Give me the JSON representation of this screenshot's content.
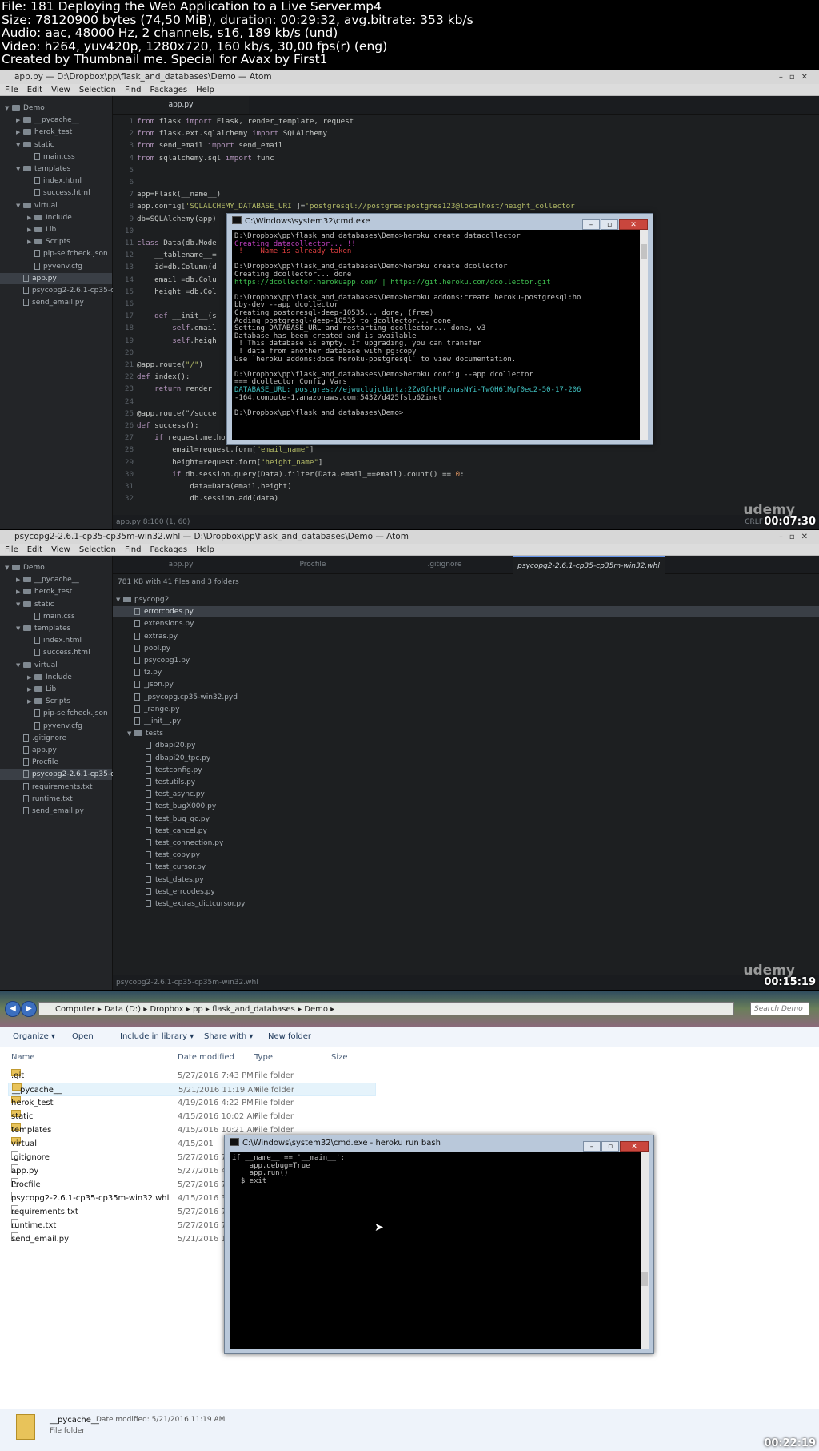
{
  "header": {
    "line1": "File: 181 Deploying the Web Application to a Live Server.mp4",
    "line2": "Size: 78120900 bytes (74,50 MiB), duration: 00:29:32, avg.bitrate: 353 kb/s",
    "line3": "Audio: aac, 48000 Hz, 2 channels, s16, 189 kb/s (und)",
    "line4": "Video: h264, yuv420p, 1280x720, 160 kb/s, 30,00 fps(r) (eng)",
    "line5": "Created by Thumbnail me. Special for Avax by First1"
  },
  "frame1": {
    "title": "app.py — D:\\Dropbox\\pp\\flask_and_databases\\Demo — Atom",
    "menu": [
      "File",
      "Edit",
      "View",
      "Selection",
      "Find",
      "Packages",
      "Help"
    ],
    "tab": "app.py",
    "tree": [
      {
        "label": "Demo",
        "kind": "root"
      },
      {
        "label": "__pycache__",
        "kind": "folder",
        "indent": 1
      },
      {
        "label": "herok_test",
        "kind": "folder",
        "indent": 1
      },
      {
        "label": "static",
        "kind": "folder-open",
        "indent": 1
      },
      {
        "label": "main.css",
        "kind": "file",
        "indent": 2
      },
      {
        "label": "templates",
        "kind": "folder-open",
        "indent": 1
      },
      {
        "label": "index.html",
        "kind": "file",
        "indent": 2
      },
      {
        "label": "success.html",
        "kind": "file",
        "indent": 2
      },
      {
        "label": "virtual",
        "kind": "folder-open",
        "indent": 1
      },
      {
        "label": "Include",
        "kind": "folder",
        "indent": 2
      },
      {
        "label": "Lib",
        "kind": "folder",
        "indent": 2
      },
      {
        "label": "Scripts",
        "kind": "folder",
        "indent": 2
      },
      {
        "label": "pip-selfcheck.json",
        "kind": "file",
        "indent": 2
      },
      {
        "label": "pyvenv.cfg",
        "kind": "file",
        "indent": 2
      },
      {
        "label": "app.py",
        "kind": "file",
        "indent": 1,
        "selected": true
      },
      {
        "label": "psycopg2-2.6.1-cp35-cp",
        "kind": "file",
        "indent": 1
      },
      {
        "label": "send_email.py",
        "kind": "file",
        "indent": 1
      }
    ],
    "lines": [
      {
        "n": "1",
        "t": "from flask import Flask, render_template, request"
      },
      {
        "n": "2",
        "t": "from flask.ext.sqlalchemy import SQLAlchemy"
      },
      {
        "n": "3",
        "t": "from send_email import send_email"
      },
      {
        "n": "4",
        "t": "from sqlalchemy.sql import func"
      },
      {
        "n": "5",
        "t": ""
      },
      {
        "n": "6",
        "t": ""
      },
      {
        "n": "7",
        "t": "app=Flask(__name__)"
      },
      {
        "n": "8",
        "t": "app.config['SQLALCHEMY_DATABASE_URI']='postgresql://postgres:postgres123@localhost/height_collector'"
      },
      {
        "n": "9",
        "t": "db=SQLAlchemy(app)"
      },
      {
        "n": "10",
        "t": ""
      },
      {
        "n": "11",
        "t": "class Data(db.Mode"
      },
      {
        "n": "12",
        "t": "    __tablename__="
      },
      {
        "n": "13",
        "t": "    id=db.Column(d"
      },
      {
        "n": "14",
        "t": "    email_=db.Colu"
      },
      {
        "n": "15",
        "t": "    height_=db.Col"
      },
      {
        "n": "16",
        "t": ""
      },
      {
        "n": "17",
        "t": "    def __init__(s"
      },
      {
        "n": "18",
        "t": "        self.email"
      },
      {
        "n": "19",
        "t": "        self.heigh"
      },
      {
        "n": "20",
        "t": ""
      },
      {
        "n": "21",
        "t": "@app.route(\"/\")"
      },
      {
        "n": "22",
        "t": "def index():"
      },
      {
        "n": "23",
        "t": "    return render_"
      },
      {
        "n": "24",
        "t": ""
      },
      {
        "n": "25",
        "t": "@app.route(\"/succe"
      },
      {
        "n": "26",
        "t": "def success():"
      },
      {
        "n": "27",
        "t": "    if request.method=='POST':"
      },
      {
        "n": "28",
        "t": "        email=request.form[\"email_name\"]"
      },
      {
        "n": "29",
        "t": "        height=request.form[\"height_name\"]"
      },
      {
        "n": "30",
        "t": "        if db.session.query(Data).filter(Data.email_==email).count() == 0:"
      },
      {
        "n": "31",
        "t": "            data=Data(email,height)"
      },
      {
        "n": "32",
        "t": "            db.session.add(data)"
      }
    ],
    "status_left": "app.py   8:100   (1, 60)",
    "status_right": "CRLF",
    "watermark": "udemy",
    "timestamp": "00:07:30",
    "cmd": {
      "title": "C:\\Windows\\system32\\cmd.exe",
      "lines": [
        {
          "t": "D:\\Dropbox\\pp\\flask_and_databases\\Demo>heroku create datacollector",
          "c": ""
        },
        {
          "t": "Creating datacollector... !!!",
          "c": "mg"
        },
        {
          "t": " !    Name is already taken",
          "c": "rd"
        },
        {
          "t": "",
          "c": ""
        },
        {
          "t": "D:\\Dropbox\\pp\\flask_and_databases\\Demo>heroku create dcollector",
          "c": ""
        },
        {
          "t": "Creating dcollector... done",
          "c": ""
        },
        {
          "t": "https://dcollector.herokuapp.com/ | https://git.heroku.com/dcollector.git",
          "c": "gr"
        },
        {
          "t": "",
          "c": ""
        },
        {
          "t": "D:\\Dropbox\\pp\\flask_and_databases\\Demo>heroku addons:create heroku-postgresql:ho",
          "c": ""
        },
        {
          "t": "bby-dev --app dcollector",
          "c": ""
        },
        {
          "t": "Creating postgresql-deep-10535... done, (free)",
          "c": ""
        },
        {
          "t": "Adding postgresql-deep-10535 to dcollector... done",
          "c": ""
        },
        {
          "t": "Setting DATABASE_URL and restarting dcollector... done, v3",
          "c": ""
        },
        {
          "t": "Database has been created and is available",
          "c": ""
        },
        {
          "t": " ! This database is empty. If upgrading, you can transfer",
          "c": ""
        },
        {
          "t": " ! data from another database with pg:copy",
          "c": ""
        },
        {
          "t": "Use `heroku addons:docs heroku-postgresql` to view documentation.",
          "c": ""
        },
        {
          "t": "",
          "c": ""
        },
        {
          "t": "D:\\Dropbox\\pp\\flask_and_databases\\Demo>heroku config --app dcollector",
          "c": ""
        },
        {
          "t": "=== dcollector Config Vars",
          "c": ""
        },
        {
          "t": "DATABASE_URL: postgres://ejwuclujctbntz:2ZvGfcHUFzmasNYi-TwQH6lMgf0ec2-50-17-206",
          "c": "cy"
        },
        {
          "t": "-164.compute-1.amazonaws.com:5432/d425fslp62inet",
          "c": ""
        },
        {
          "t": "",
          "c": ""
        },
        {
          "t": "D:\\Dropbox\\pp\\flask_and_databases\\Demo>",
          "c": ""
        }
      ]
    }
  },
  "frame2": {
    "title": "psycopg2-2.6.1-cp35-cp35m-win32.whl — D:\\Dropbox\\pp\\flask_and_databases\\Demo — Atom",
    "menu": [
      "File",
      "Edit",
      "View",
      "Selection",
      "Find",
      "Packages",
      "Help"
    ],
    "tabs": [
      "app.py",
      "Procfile",
      ".gitignore",
      "psycopg2-2.6.1-cp35-cp35m-win32.whl"
    ],
    "tree": [
      {
        "label": "Demo",
        "kind": "root"
      },
      {
        "label": "__pycache__",
        "kind": "folder",
        "indent": 1
      },
      {
        "label": "herok_test",
        "kind": "folder",
        "indent": 1
      },
      {
        "label": "static",
        "kind": "folder-open",
        "indent": 1
      },
      {
        "label": "main.css",
        "kind": "file",
        "indent": 2
      },
      {
        "label": "templates",
        "kind": "folder-open",
        "indent": 1
      },
      {
        "label": "index.html",
        "kind": "file",
        "indent": 2
      },
      {
        "label": "success.html",
        "kind": "file",
        "indent": 2
      },
      {
        "label": "virtual",
        "kind": "folder-open",
        "indent": 1
      },
      {
        "label": "Include",
        "kind": "folder",
        "indent": 2
      },
      {
        "label": "Lib",
        "kind": "folder",
        "indent": 2
      },
      {
        "label": "Scripts",
        "kind": "folder",
        "indent": 2
      },
      {
        "label": "pip-selfcheck.json",
        "kind": "file",
        "indent": 2
      },
      {
        "label": "pyvenv.cfg",
        "kind": "file",
        "indent": 2
      },
      {
        "label": ".gitignore",
        "kind": "file",
        "indent": 1
      },
      {
        "label": "app.py",
        "kind": "file",
        "indent": 1
      },
      {
        "label": "Procfile",
        "kind": "file",
        "indent": 1
      },
      {
        "label": "psycopg2-2.6.1-cp35-c",
        "kind": "file",
        "indent": 1,
        "selected": true
      },
      {
        "label": "requirements.txt",
        "kind": "file",
        "indent": 1
      },
      {
        "label": "runtime.txt",
        "kind": "file",
        "indent": 1
      },
      {
        "label": "send_email.py",
        "kind": "file",
        "indent": 1
      }
    ],
    "archive_summary": "781 KB with 41 files and 3 folders",
    "archive": [
      {
        "label": "psycopg2",
        "kind": "folder-open",
        "indent": 0
      },
      {
        "label": "errorcodes.py",
        "kind": "file",
        "indent": 1,
        "selected": true
      },
      {
        "label": "extensions.py",
        "kind": "file",
        "indent": 1
      },
      {
        "label": "extras.py",
        "kind": "file",
        "indent": 1
      },
      {
        "label": "pool.py",
        "kind": "file",
        "indent": 1
      },
      {
        "label": "psycopg1.py",
        "kind": "file",
        "indent": 1
      },
      {
        "label": "tz.py",
        "kind": "file",
        "indent": 1
      },
      {
        "label": "_json.py",
        "kind": "file",
        "indent": 1
      },
      {
        "label": "_psycopg.cp35-win32.pyd",
        "kind": "file",
        "indent": 1
      },
      {
        "label": "_range.py",
        "kind": "file",
        "indent": 1
      },
      {
        "label": "__init__.py",
        "kind": "file",
        "indent": 1
      },
      {
        "label": "tests",
        "kind": "folder-open",
        "indent": 1
      },
      {
        "label": "dbapi20.py",
        "kind": "file",
        "indent": 2
      },
      {
        "label": "dbapi20_tpc.py",
        "kind": "file",
        "indent": 2
      },
      {
        "label": "testconfig.py",
        "kind": "file",
        "indent": 2
      },
      {
        "label": "testutils.py",
        "kind": "file",
        "indent": 2
      },
      {
        "label": "test_async.py",
        "kind": "file",
        "indent": 2
      },
      {
        "label": "test_bugX000.py",
        "kind": "file",
        "indent": 2
      },
      {
        "label": "test_bug_gc.py",
        "kind": "file",
        "indent": 2
      },
      {
        "label": "test_cancel.py",
        "kind": "file",
        "indent": 2
      },
      {
        "label": "test_connection.py",
        "kind": "file",
        "indent": 2
      },
      {
        "label": "test_copy.py",
        "kind": "file",
        "indent": 2
      },
      {
        "label": "test_cursor.py",
        "kind": "file",
        "indent": 2
      },
      {
        "label": "test_dates.py",
        "kind": "file",
        "indent": 2
      },
      {
        "label": "test_errcodes.py",
        "kind": "file",
        "indent": 2
      },
      {
        "label": "test_extras_dictcursor.py",
        "kind": "file",
        "indent": 2
      }
    ],
    "status_left": "psycopg2-2.6.1-cp35-cp35m-win32.whl",
    "watermark": "udemy",
    "timestamp": "00:15:19"
  },
  "frame3": {
    "breadcrumb": [
      "Computer",
      "Data (D:)",
      "Dropbox",
      "pp",
      "flask_and_databases",
      "Demo"
    ],
    "search_placeholder": "Search Demo",
    "toolbar": [
      "Organize ▾",
      "Open",
      "Include in library ▾",
      "Share with ▾",
      "New folder"
    ],
    "columns": [
      "Name",
      "Date modified",
      "Type",
      "Size"
    ],
    "rows": [
      {
        "name": ".git",
        "date": "5/27/2016 7:43 PM",
        "type": "File folder",
        "kind": "folder"
      },
      {
        "name": "__pycache__",
        "date": "5/21/2016 11:19 AM",
        "type": "File folder",
        "kind": "folder",
        "hl": true
      },
      {
        "name": "herok_test",
        "date": "4/19/2016 4:22 PM",
        "type": "File folder",
        "kind": "folder"
      },
      {
        "name": "static",
        "date": "4/15/2016 10:02 AM",
        "type": "File folder",
        "kind": "folder"
      },
      {
        "name": "templates",
        "date": "4/15/2016 10:21 AM",
        "type": "File folder",
        "kind": "folder"
      },
      {
        "name": "virtual",
        "date": "4/15/201",
        "type": "",
        "kind": "folder"
      },
      {
        "name": ".gitignore",
        "date": "5/27/2016 7:",
        "type": "",
        "kind": "file"
      },
      {
        "name": "app.py",
        "date": "5/27/2016 4:",
        "type": "",
        "kind": "file"
      },
      {
        "name": "Procfile",
        "date": "5/27/2016 7:",
        "type": "",
        "kind": "file"
      },
      {
        "name": "psycopg2-2.6.1-cp35-cp35m-win32.whl",
        "date": "4/15/2016 3:",
        "type": "",
        "kind": "file"
      },
      {
        "name": "requirements.txt",
        "date": "5/27/2016 7:",
        "type": "",
        "kind": "file"
      },
      {
        "name": "runtime.txt",
        "date": "5/27/2016 7:",
        "type": "",
        "kind": "file"
      },
      {
        "name": "send_email.py",
        "date": "5/21/2016 11:",
        "type": "",
        "kind": "file"
      }
    ],
    "details": {
      "name": "__pycache__",
      "date_label": "Date modified: 5/21/2016 11:19 AM",
      "type": "File folder"
    },
    "timestamp": "00:22:19",
    "cmd": {
      "title": "C:\\Windows\\system32\\cmd.exe - heroku  run bash",
      "lines": [
        {
          "t": "if __name__ == '__main__':",
          "c": ""
        },
        {
          "t": "    app.debug=True",
          "c": ""
        },
        {
          "t": "    app.run()",
          "c": ""
        },
        {
          "t": "  $ exit",
          "c": ""
        }
      ]
    }
  }
}
